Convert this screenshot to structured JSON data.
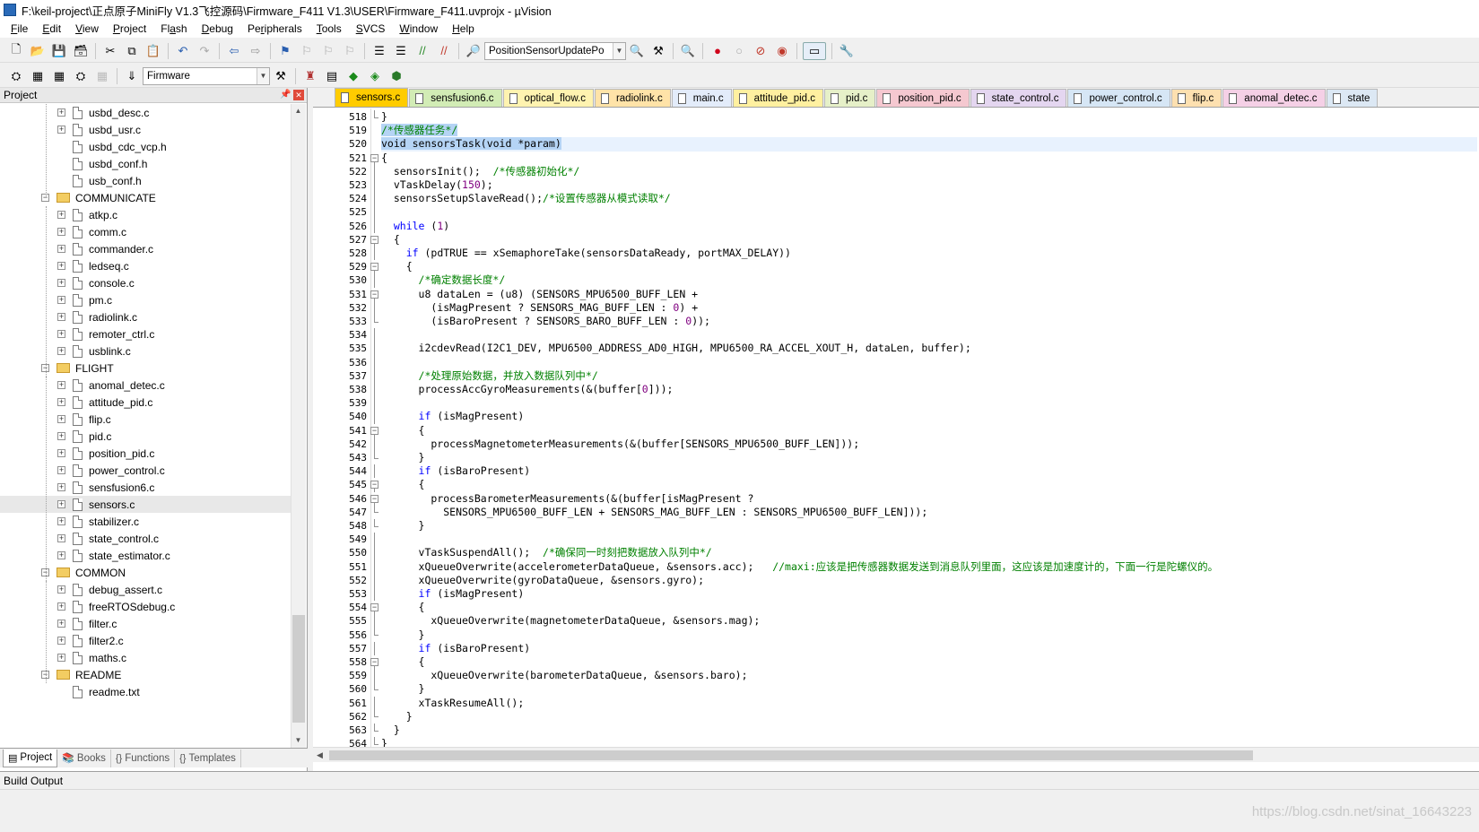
{
  "window": {
    "title": "F:\\keil-project\\正点原子MiniFly V1.3飞控源码\\Firmware_F411 V1.3\\USER\\Firmware_F411.uvprojx - µVision"
  },
  "menu": [
    {
      "pre": "",
      "u": "F",
      "post": "ile"
    },
    {
      "pre": "",
      "u": "E",
      "post": "dit"
    },
    {
      "pre": "",
      "u": "V",
      "post": "iew"
    },
    {
      "pre": "",
      "u": "P",
      "post": "roject"
    },
    {
      "pre": "Fl",
      "u": "a",
      "post": "sh"
    },
    {
      "pre": "",
      "u": "D",
      "post": "ebug"
    },
    {
      "pre": "Pe",
      "u": "r",
      "post": "ipherals"
    },
    {
      "pre": "",
      "u": "T",
      "post": "ools"
    },
    {
      "pre": "",
      "u": "S",
      "post": "VCS"
    },
    {
      "pre": "",
      "u": "W",
      "post": "indow"
    },
    {
      "pre": "",
      "u": "H",
      "post": "elp"
    }
  ],
  "toolbar": {
    "find_combo": "PositionSensorUpdatePo",
    "target_combo": "Firmware"
  },
  "project": {
    "header": "Project",
    "tree": [
      {
        "label": "usbd_desc.c",
        "type": "file",
        "level": 2,
        "expander": "+"
      },
      {
        "label": "usbd_usr.c",
        "type": "file",
        "level": 2,
        "expander": "+"
      },
      {
        "label": "usbd_cdc_vcp.h",
        "type": "file",
        "level": 2,
        "expander": ""
      },
      {
        "label": "usbd_conf.h",
        "type": "file",
        "level": 2,
        "expander": ""
      },
      {
        "label": "usb_conf.h",
        "type": "file",
        "level": 2,
        "expander": ""
      },
      {
        "label": "COMMUNICATE",
        "type": "folder",
        "level": 1,
        "expander": "-"
      },
      {
        "label": "atkp.c",
        "type": "file",
        "level": 2,
        "expander": "+"
      },
      {
        "label": "comm.c",
        "type": "file",
        "level": 2,
        "expander": "+"
      },
      {
        "label": "commander.c",
        "type": "file",
        "level": 2,
        "expander": "+"
      },
      {
        "label": "ledseq.c",
        "type": "file",
        "level": 2,
        "expander": "+"
      },
      {
        "label": "console.c",
        "type": "file",
        "level": 2,
        "expander": "+"
      },
      {
        "label": "pm.c",
        "type": "file",
        "level": 2,
        "expander": "+"
      },
      {
        "label": "radiolink.c",
        "type": "file",
        "level": 2,
        "expander": "+"
      },
      {
        "label": "remoter_ctrl.c",
        "type": "file",
        "level": 2,
        "expander": "+"
      },
      {
        "label": "usblink.c",
        "type": "file",
        "level": 2,
        "expander": "+"
      },
      {
        "label": "FLIGHT",
        "type": "folder",
        "level": 1,
        "expander": "-"
      },
      {
        "label": "anomal_detec.c",
        "type": "file",
        "level": 2,
        "expander": "+"
      },
      {
        "label": "attitude_pid.c",
        "type": "file",
        "level": 2,
        "expander": "+"
      },
      {
        "label": "flip.c",
        "type": "file",
        "level": 2,
        "expander": "+"
      },
      {
        "label": "pid.c",
        "type": "file",
        "level": 2,
        "expander": "+"
      },
      {
        "label": "position_pid.c",
        "type": "file",
        "level": 2,
        "expander": "+"
      },
      {
        "label": "power_control.c",
        "type": "file",
        "level": 2,
        "expander": "+"
      },
      {
        "label": "sensfusion6.c",
        "type": "file",
        "level": 2,
        "expander": "+"
      },
      {
        "label": "sensors.c",
        "type": "file",
        "level": 2,
        "expander": "+",
        "selected": true
      },
      {
        "label": "stabilizer.c",
        "type": "file",
        "level": 2,
        "expander": "+"
      },
      {
        "label": "state_control.c",
        "type": "file",
        "level": 2,
        "expander": "+"
      },
      {
        "label": "state_estimator.c",
        "type": "file",
        "level": 2,
        "expander": "+"
      },
      {
        "label": "COMMON",
        "type": "folder",
        "level": 1,
        "expander": "-"
      },
      {
        "label": "debug_assert.c",
        "type": "file",
        "level": 2,
        "expander": "+"
      },
      {
        "label": "freeRTOSdebug.c",
        "type": "file",
        "level": 2,
        "expander": "+"
      },
      {
        "label": "filter.c",
        "type": "file",
        "level": 2,
        "expander": "+"
      },
      {
        "label": "filter2.c",
        "type": "file",
        "level": 2,
        "expander": "+"
      },
      {
        "label": "maths.c",
        "type": "file",
        "level": 2,
        "expander": "+"
      },
      {
        "label": "README",
        "type": "folder",
        "level": 1,
        "expander": "-"
      },
      {
        "label": "readme.txt",
        "type": "file",
        "level": 2,
        "expander": ""
      }
    ],
    "tabs": [
      {
        "label": "Project",
        "icon": "project-icon",
        "active": true
      },
      {
        "label": "Books",
        "icon": "books-icon",
        "active": false
      },
      {
        "label": "Functions",
        "icon": "functions-icon",
        "active": false
      },
      {
        "label": "Templates",
        "icon": "templates-icon",
        "active": false
      }
    ]
  },
  "editor": {
    "tabs": [
      {
        "label": "sensors.c",
        "color": "#ffcc00",
        "active": true
      },
      {
        "label": "sensfusion6.c",
        "color": "#d2ecb5"
      },
      {
        "label": "optical_flow.c",
        "color": "#fff3b0"
      },
      {
        "label": "radiolink.c",
        "color": "#ffe3a8"
      },
      {
        "label": "main.c",
        "color": "#e3ecfa"
      },
      {
        "label": "attitude_pid.c",
        "color": "#fff0a0"
      },
      {
        "label": "pid.c",
        "color": "#e6f0c8"
      },
      {
        "label": "position_pid.c",
        "color": "#f5c8d0"
      },
      {
        "label": "state_control.c",
        "color": "#e4d6f0"
      },
      {
        "label": "power_control.c",
        "color": "#d6e6f5"
      },
      {
        "label": "flip.c",
        "color": "#fde0b0"
      },
      {
        "label": "anomal_detec.c",
        "color": "#f5d0e6"
      },
      {
        "label": "state",
        "color": "#dce8f4"
      }
    ],
    "current_line": 520,
    "lines": [
      {
        "n": "518",
        "fold": "end",
        "html": "}"
      },
      {
        "n": "519",
        "fold": "",
        "html": "<span class=\"sel\"><span class=\"cm\">/*传感器任务*/</span></span>"
      },
      {
        "n": "520",
        "fold": "",
        "html": "<span class=\"sel\">void sensorsTask(void *param)</span>",
        "cur": true
      },
      {
        "n": "521",
        "fold": "box",
        "html": "{"
      },
      {
        "n": "522",
        "fold": "line",
        "html": "  sensorsInit();  <span class=\"cm\">/*传感器初始化*/</span>"
      },
      {
        "n": "523",
        "fold": "line",
        "html": "  vTaskDelay(<span class=\"num\">150</span>);"
      },
      {
        "n": "524",
        "fold": "line",
        "html": "  sensorsSetupSlaveRead();<span class=\"cm\">/*设置传感器从模式读取*/</span>"
      },
      {
        "n": "525",
        "fold": "line",
        "html": ""
      },
      {
        "n": "526",
        "fold": "line",
        "html": "  <span class=\"kw\">while</span> (<span class=\"num\">1</span>)"
      },
      {
        "n": "527",
        "fold": "box",
        "html": "  {"
      },
      {
        "n": "528",
        "fold": "line",
        "html": "    <span class=\"kw\">if</span> (pdTRUE == xSemaphoreTake(sensorsDataReady, portMAX_DELAY))"
      },
      {
        "n": "529",
        "fold": "box",
        "html": "    {"
      },
      {
        "n": "530",
        "fold": "line",
        "html": "      <span class=\"cm\">/*确定数据长度*/</span>"
      },
      {
        "n": "531",
        "fold": "box",
        "html": "      u8 dataLen = (u8) (SENSORS_MPU6500_BUFF_LEN +"
      },
      {
        "n": "532",
        "fold": "line",
        "html": "        (isMagPresent ? SENSORS_MAG_BUFF_LEN : <span class=\"num\">0</span>) +"
      },
      {
        "n": "533",
        "fold": "end",
        "html": "        (isBaroPresent ? SENSORS_BARO_BUFF_LEN : <span class=\"num\">0</span>));"
      },
      {
        "n": "534",
        "fold": "line",
        "html": ""
      },
      {
        "n": "535",
        "fold": "line",
        "html": "      i2cdevRead(I2C1_DEV, MPU6500_ADDRESS_AD0_HIGH, MPU6500_RA_ACCEL_XOUT_H, dataLen, buffer);"
      },
      {
        "n": "536",
        "fold": "line",
        "html": ""
      },
      {
        "n": "537",
        "fold": "line",
        "html": "      <span class=\"cm\">/*处理原始数据，并放入数据队列中*/</span>"
      },
      {
        "n": "538",
        "fold": "line",
        "html": "      processAccGyroMeasurements(&amp;(buffer[<span class=\"num\">0</span>]));"
      },
      {
        "n": "539",
        "fold": "line",
        "html": ""
      },
      {
        "n": "540",
        "fold": "line",
        "html": "      <span class=\"kw\">if</span> (isMagPresent)"
      },
      {
        "n": "541",
        "fold": "box",
        "html": "      {"
      },
      {
        "n": "542",
        "fold": "line",
        "html": "        processMagnetometerMeasurements(&amp;(buffer[SENSORS_MPU6500_BUFF_LEN]));"
      },
      {
        "n": "543",
        "fold": "end",
        "html": "      }"
      },
      {
        "n": "544",
        "fold": "line",
        "html": "      <span class=\"kw\">if</span> (isBaroPresent)"
      },
      {
        "n": "545",
        "fold": "box",
        "html": "      {"
      },
      {
        "n": "546",
        "fold": "box",
        "html": "        processBarometerMeasurements(&amp;(buffer[isMagPresent ?"
      },
      {
        "n": "547",
        "fold": "end",
        "html": "          SENSORS_MPU6500_BUFF_LEN + SENSORS_MAG_BUFF_LEN : SENSORS_MPU6500_BUFF_LEN]));"
      },
      {
        "n": "548",
        "fold": "end",
        "html": "      }"
      },
      {
        "n": "549",
        "fold": "line",
        "html": ""
      },
      {
        "n": "550",
        "fold": "line",
        "html": "      vTaskSuspendAll();  <span class=\"cm\">/*确保同一时刻把数据放入队列中*/</span>"
      },
      {
        "n": "551",
        "fold": "line",
        "html": "      xQueueOverwrite(accelerometerDataQueue, &amp;sensors.acc);   <span class=\"cm\">//maxi:应该是把传感器数据发送到消息队列里面，这应该是加速度计的，下面一行是陀螺仪的。</span>"
      },
      {
        "n": "552",
        "fold": "line",
        "html": "      xQueueOverwrite(gyroDataQueue, &amp;sensors.gyro);"
      },
      {
        "n": "553",
        "fold": "line",
        "html": "      <span class=\"kw\">if</span> (isMagPresent)"
      },
      {
        "n": "554",
        "fold": "box",
        "html": "      {"
      },
      {
        "n": "555",
        "fold": "line",
        "html": "        xQueueOverwrite(magnetometerDataQueue, &amp;sensors.mag);"
      },
      {
        "n": "556",
        "fold": "end",
        "html": "      }"
      },
      {
        "n": "557",
        "fold": "line",
        "html": "      <span class=\"kw\">if</span> (isBaroPresent)"
      },
      {
        "n": "558",
        "fold": "box",
        "html": "      {"
      },
      {
        "n": "559",
        "fold": "line",
        "html": "        xQueueOverwrite(barometerDataQueue, &amp;sensors.baro);"
      },
      {
        "n": "560",
        "fold": "end",
        "html": "      }"
      },
      {
        "n": "561",
        "fold": "line",
        "html": "      xTaskResumeAll();"
      },
      {
        "n": "562",
        "fold": "end",
        "html": "    }"
      },
      {
        "n": "563",
        "fold": "end",
        "html": "  }"
      },
      {
        "n": "564",
        "fold": "end",
        "html": "}"
      }
    ]
  },
  "status": {
    "build_output": "Build Output"
  },
  "watermark": "https://blog.csdn.net/sinat_16643223"
}
